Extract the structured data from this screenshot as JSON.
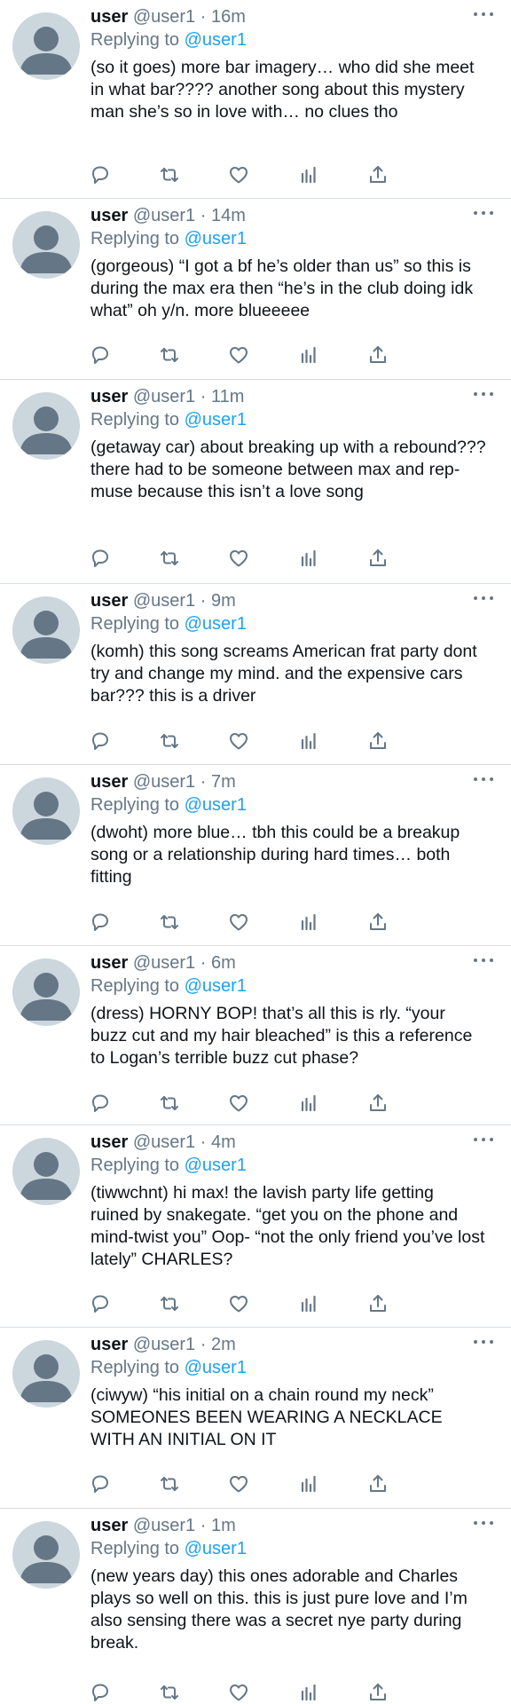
{
  "tweets": [
    {
      "username": "user",
      "handle": "@user1",
      "separator": "·",
      "time": "16m",
      "replying_prefix": "Replying to",
      "replying_to": "@user1",
      "text": "(so it goes) more bar imagery… who did she meet in what bar???? another song about this mystery man she’s so in love with… no clues tho"
    },
    {
      "username": "user",
      "handle": "@user1",
      "separator": "·",
      "time": "14m",
      "replying_prefix": "Replying to",
      "replying_to": "@user1",
      "text": "(gorgeous) “I got a bf he’s older than us” so this is during the max era then “he’s in the club doing idk what” oh y/n. more blueeeee"
    },
    {
      "username": "user",
      "handle": "@user1",
      "separator": "·",
      "time": "11m",
      "replying_prefix": "Replying to",
      "replying_to": "@user1",
      "text": "(getaway car) about breaking up with a rebound??? there had to be someone between max and rep-muse because this isn’t a love song"
    },
    {
      "username": "user",
      "handle": "@user1",
      "separator": "·",
      "time": "9m",
      "replying_prefix": "Replying to",
      "replying_to": "@user1",
      "text": "(komh) this song screams American frat party dont try and change my mind. and the expensive cars bar??? this is a driver"
    },
    {
      "username": "user",
      "handle": "@user1",
      "separator": "·",
      "time": "7m",
      "replying_prefix": "Replying to",
      "replying_to": "@user1",
      "text": "(dwoht) more blue… tbh this could be a breakup song or a relationship during hard times… both fitting"
    },
    {
      "username": "user",
      "handle": "@user1",
      "separator": "·",
      "time": "6m",
      "replying_prefix": "Replying to",
      "replying_to": "@user1",
      "text": "(dress) HORNY BOP! that’s all this is rly. “your buzz cut and my hair bleached” is this a reference to Logan’s terrible buzz cut phase?"
    },
    {
      "username": "user",
      "handle": "@user1",
      "separator": "·",
      "time": "4m",
      "replying_prefix": "Replying to",
      "replying_to": "@user1",
      "text": "(tiwwchnt) hi max! the lavish party life getting ruined by snakegate. “get you on the phone and mind-twist you” Oop- “not the only friend you’ve lost lately” CHARLES?"
    },
    {
      "username": "user",
      "handle": "@user1",
      "separator": "·",
      "time": "2m",
      "replying_prefix": "Replying to",
      "replying_to": "@user1",
      "text": "(ciwyw) “his initial on a chain round my neck” SOMEONES BEEN WEARING A NECKLACE WITH AN INITIAL ON IT"
    },
    {
      "username": "user",
      "handle": "@user1",
      "separator": "·",
      "time": "1m",
      "replying_prefix": "Replying to",
      "replying_to": "@user1",
      "text": "(new years day) this ones adorable and Charles plays so well on this. this is just pure love and I’m also sensing there was a secret nye party during break."
    }
  ],
  "action_icons": [
    "reply-icon",
    "retweet-icon",
    "like-icon",
    "analytics-icon",
    "share-icon"
  ],
  "colors": {
    "icon": "#657786",
    "link": "#1da1f2",
    "text": "#0f1419",
    "avatar_bg": "#ccd6dd",
    "avatar_fg": "#657786",
    "divider": "#d9dee2"
  }
}
